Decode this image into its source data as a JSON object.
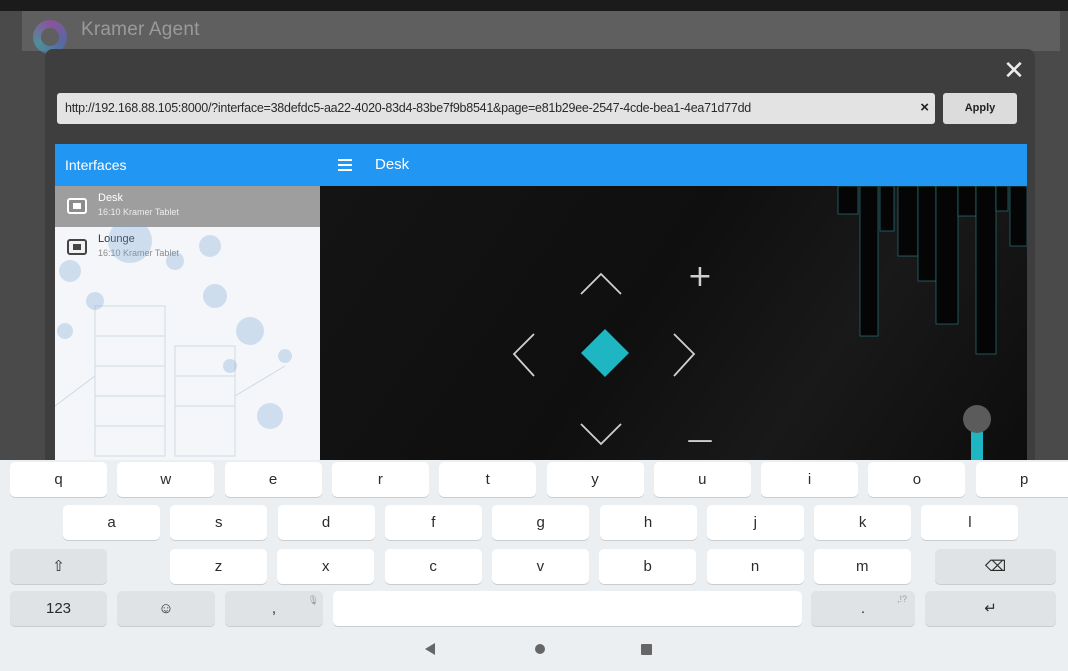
{
  "app": {
    "title": "Kramer Agent"
  },
  "dialog": {
    "url": "http://192.168.88.105:8000/?interface=38defdc5-aa22-4020-83d4-83be7f9b8541&page=e81b29ee-2547-4cde-bea1-4ea71d77dd",
    "clear_glyph": "×",
    "apply_label": "Apply",
    "close_glyph": "✕"
  },
  "sidebar": {
    "header": "Interfaces",
    "items": [
      {
        "title": "Desk",
        "subtitle": "16:10 Kramer Tablet",
        "selected": true
      },
      {
        "title": "Lounge",
        "subtitle": "16:10 Kramer Tablet",
        "selected": false
      }
    ]
  },
  "main": {
    "title": "Desk",
    "controls": {
      "plus": "+",
      "minus": "—",
      "accent_color": "#1fb6c4",
      "slider_level": 0.1
    }
  },
  "keyboard": {
    "row1": [
      "q",
      "w",
      "e",
      "r",
      "t",
      "y",
      "u",
      "i",
      "o",
      "p"
    ],
    "row2": [
      "a",
      "s",
      "d",
      "f",
      "g",
      "h",
      "j",
      "k",
      "l"
    ],
    "row3": [
      "z",
      "x",
      "c",
      "v",
      "b",
      "n",
      "m"
    ],
    "shift_glyph": "⇧",
    "backspace_glyph": "⌫",
    "numbers_label": "123",
    "emoji_glyph": "☺",
    "comma_label": ",",
    "period_label": ".",
    "period_hint": ",!?",
    "enter_glyph": "↵"
  },
  "navbar": {
    "icons": [
      "back-icon",
      "home-icon",
      "recents-icon"
    ]
  }
}
